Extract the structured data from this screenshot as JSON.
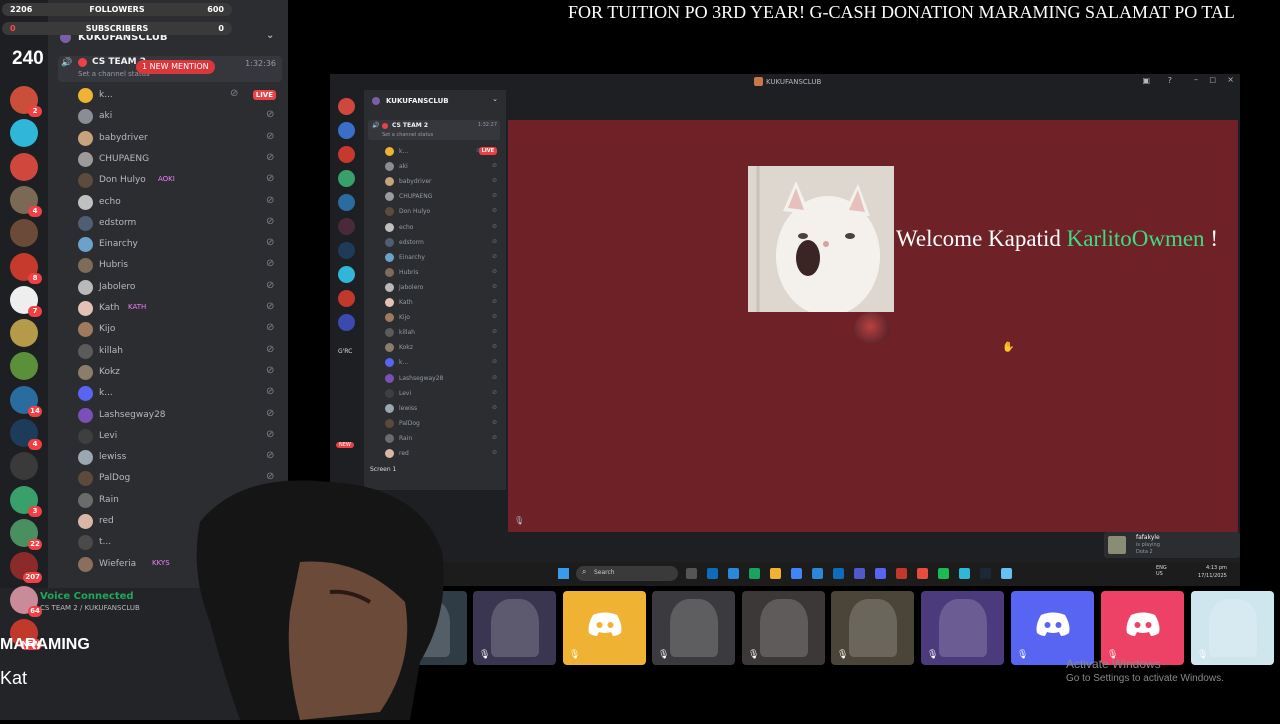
{
  "overlay": {
    "followers_left": "2206",
    "followers_label": "FOLLOWERS",
    "followers_right": "600",
    "subscribers_left": "0",
    "subscribers_label": "SUBSCRIBERS",
    "subscribers_right": "0",
    "counter": "240",
    "ticker": "FOR TUITION PO 3RD YEAR! G-CASH DONATION MARAMING SALAMAT PO TAL",
    "bottom_text_1": "MARAMING",
    "bottom_text_2": "Kat"
  },
  "server_rail": {
    "badges": [
      "2",
      "",
      "",
      "4",
      "",
      "8",
      "7",
      "",
      "",
      "14",
      "4",
      "",
      "3",
      "22",
      "207",
      "64",
      "NEW"
    ]
  },
  "channel_panel": {
    "guild_name": "KUKUFANSCLUB",
    "channel_name": "CS TEAM 2",
    "channel_status": "Set a channel status",
    "mention_badge": "1 NEW MENTION",
    "timer": "1:32:36",
    "users": [
      {
        "name": "k...",
        "live": "LIVE",
        "color": "#f0b232"
      },
      {
        "name": "aki",
        "color": "#8a8d93"
      },
      {
        "name": "babydriver",
        "color": "#c8a27a"
      },
      {
        "name": "CHUPAENG",
        "color": "#9b9b9b"
      },
      {
        "name": "Don Hulyo",
        "tag": "AOKI",
        "color": "#5d4b3e"
      },
      {
        "name": "echo",
        "color": "#c0c0c0"
      },
      {
        "name": "edstorm",
        "color": "#4f5d75"
      },
      {
        "name": "Einarchy",
        "color": "#6aa2c9"
      },
      {
        "name": "Hubris",
        "color": "#7e6b5a"
      },
      {
        "name": "Jabolero",
        "color": "#b9b9b9"
      },
      {
        "name": "Kath",
        "tag": "KATH",
        "color": "#e3c1b5"
      },
      {
        "name": "Kijo",
        "color": "#a07a5c"
      },
      {
        "name": "killah",
        "color": "#5b5b5b"
      },
      {
        "name": "Kokz",
        "color": "#8c7c6b"
      },
      {
        "name": "k...",
        "color": "#5865f2"
      },
      {
        "name": "Lashsegway28",
        "color": "#7b4fb8"
      },
      {
        "name": "Levi",
        "color": "#3f3f3f"
      },
      {
        "name": "lewiss",
        "color": "#9aa6b0"
      },
      {
        "name": "PalDog",
        "color": "#5c4a3a"
      },
      {
        "name": "Rain",
        "color": "#6b6b6b"
      },
      {
        "name": "red",
        "color": "#d9b7a4"
      },
      {
        "name": "t...",
        "color": "#4a4a4a"
      },
      {
        "name": "Wieferia",
        "tag": "KKYS",
        "color": "#8b6f5d"
      }
    ],
    "voice_status": "Voice Connected",
    "voice_detail": "CS TEAM 2 / KUKUFANSCLUB"
  },
  "inner_window": {
    "title": "KUKUFANSCLUB",
    "guild_name": "KUKUFANSCLUB",
    "channel_name": "CS TEAM 2",
    "channel_status": "Set a channel status",
    "timer": "1:32:27",
    "live": "LIVE",
    "users": [
      "k...",
      "aki",
      "babydriver",
      "CHUPAENG",
      "Don Hulyo",
      "echo",
      "edstorm",
      "Einarchy",
      "Hubris",
      "Jabolero",
      "Kath",
      "Kijo",
      "killah",
      "Kokz",
      "k...",
      "Lashsegway28",
      "Levi",
      "lewiss",
      "PalDog",
      "Rain",
      "red"
    ],
    "screen_label": "Screen 1",
    "rail_label": "G'RC",
    "rail_new": "NEW",
    "welcome_prefix": "Welcome Kapatid",
    "welcome_name": "KarlitoOwmen",
    "welcome_suffix": "!",
    "toast_name": "fafakyle",
    "toast_status": "is playing",
    "toast_game": "Dota 2",
    "taskbar_search": "Search",
    "taskbar_lang": "ENG\nUS",
    "taskbar_time": "4:13 pm",
    "taskbar_date": "17/11/2025"
  },
  "tiles": [
    {
      "kind": "photo",
      "color": "#2f3b45"
    },
    {
      "kind": "photo",
      "color": "#3a3550"
    },
    {
      "kind": "discord",
      "color": "#f0b232"
    },
    {
      "kind": "photo",
      "color": "#3b3b3f"
    },
    {
      "kind": "photo",
      "color": "#3d3838"
    },
    {
      "kind": "photo",
      "color": "#4a4538"
    },
    {
      "kind": "photo",
      "color": "#4b3a7c"
    },
    {
      "kind": "discord",
      "color": "#5865f2"
    },
    {
      "kind": "discord",
      "color": "#ed4265"
    },
    {
      "kind": "photo",
      "color": "#cfe6ee"
    }
  ],
  "activate_windows": {
    "title": "Activate Windows",
    "subtitle": "Go to Settings to activate Windows."
  }
}
